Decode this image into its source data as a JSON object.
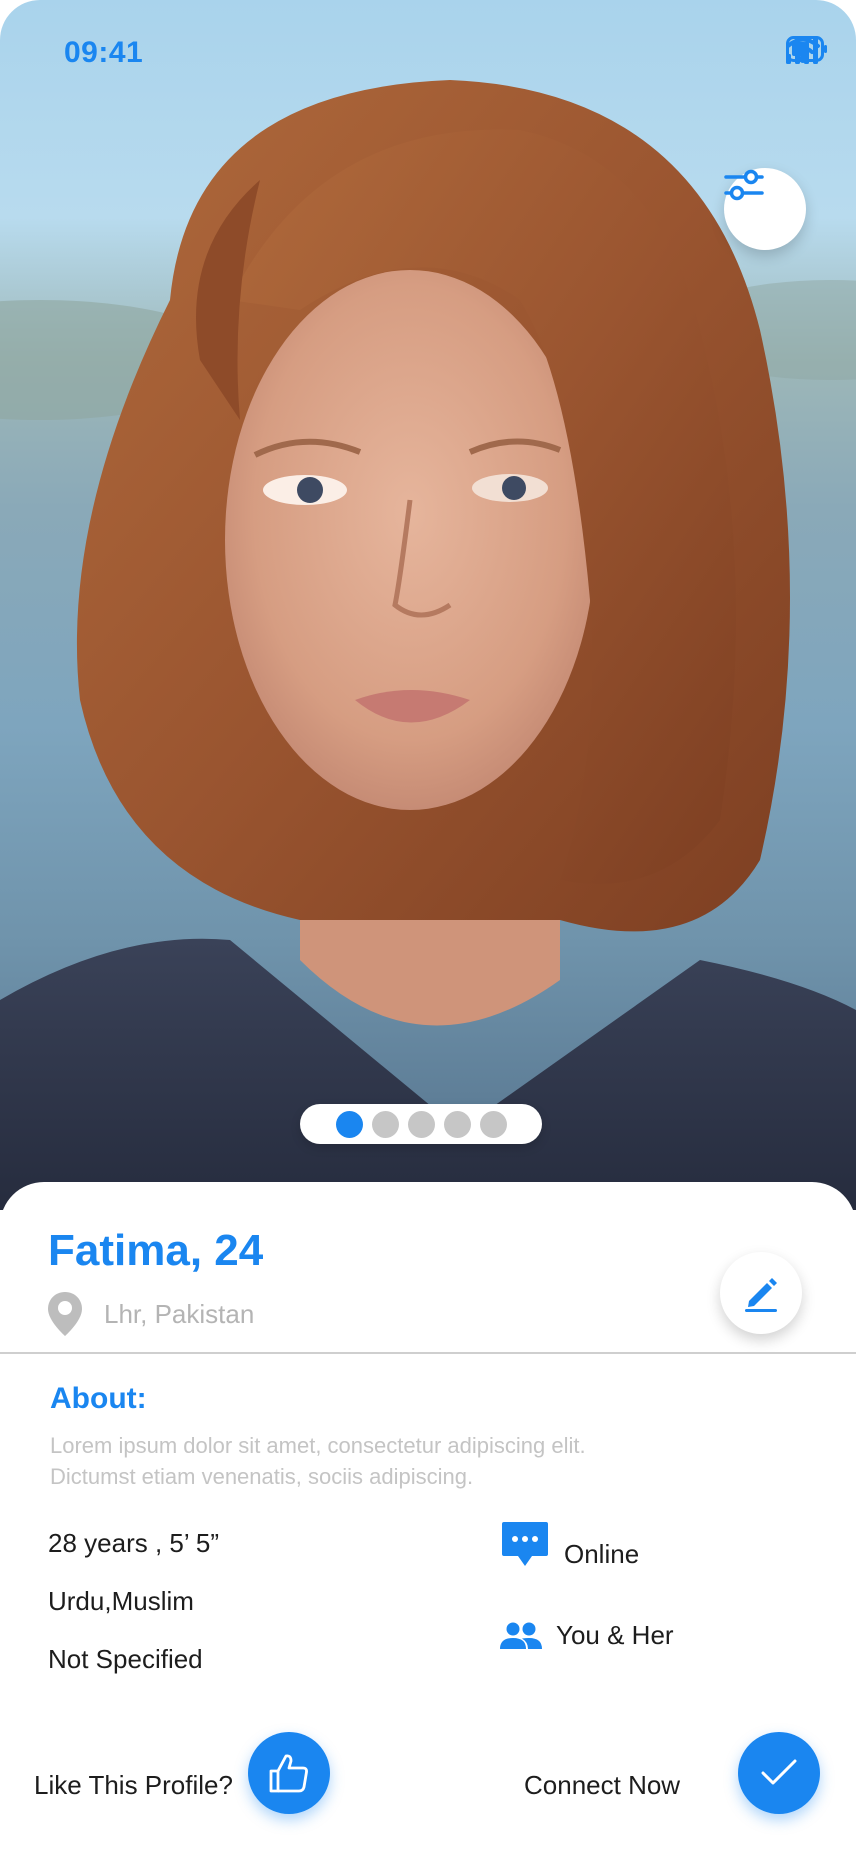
{
  "status_bar": {
    "time": "09:41"
  },
  "profile": {
    "name": "Fatima, 24",
    "location": "Lhr, Pakistan",
    "photo_count": 5,
    "active_photo": 1
  },
  "about": {
    "title": "About:",
    "text_line1": "Lorem ipsum dolor sit amet, consectetur adipiscing elit.",
    "text_line2": "Dictumst etiam venenatis, sociis adipiscing."
  },
  "details": {
    "age_height": "28 years , 5’ 5”",
    "language_religion": "Urdu,Muslim",
    "other": "Not Specified"
  },
  "status": {
    "online_label": "Online",
    "together_label": "You & Her"
  },
  "actions": {
    "like_label": "Like This Profile?",
    "connect_label": "Connect Now"
  },
  "colors": {
    "accent": "#1a86f0",
    "muted_text": "#b4b4b4",
    "body_text": "#1d1d1d"
  },
  "icons": {
    "filter": "sliders-icon",
    "edit": "pencil-icon",
    "location": "map-pin-icon",
    "online": "chat-bubble-icon",
    "together": "people-icon",
    "like": "thumbs-up-icon",
    "connect": "checkmark-icon"
  }
}
